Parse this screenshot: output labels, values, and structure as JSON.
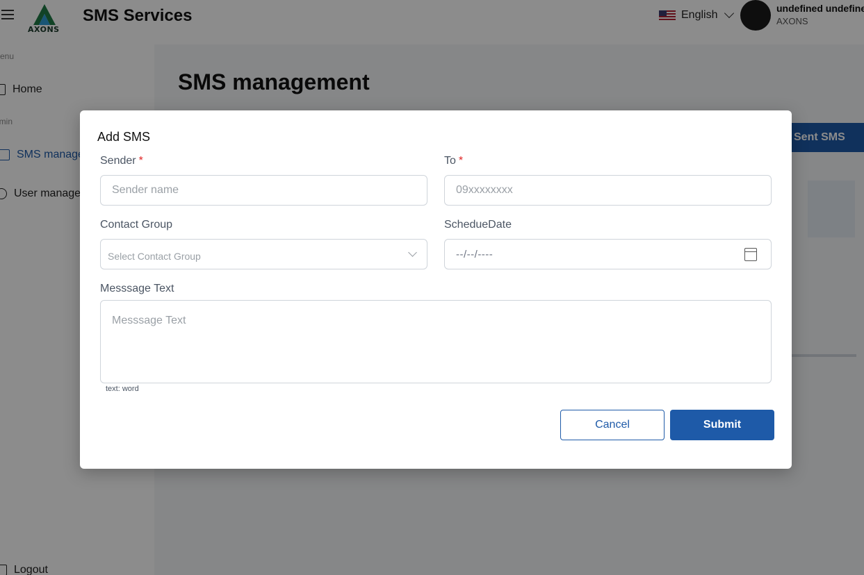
{
  "header": {
    "app_title": "SMS Services",
    "logo_text": "AXONS",
    "language": "English",
    "user_name": "undefined undefined",
    "user_org": "AXONS"
  },
  "sidebar": {
    "menu_label": "Menu",
    "admin_label": "Admin",
    "items": [
      {
        "label": "Home",
        "active": false
      },
      {
        "label": "SMS management",
        "active": true
      },
      {
        "label": "User management",
        "active": false
      }
    ],
    "logout_label": "Logout"
  },
  "main": {
    "page_title": "SMS management",
    "sent_button_label": "Sent SMS"
  },
  "modal": {
    "title": "Add SMS",
    "sender": {
      "label": "Sender",
      "required": "*",
      "placeholder": "Sender name"
    },
    "to": {
      "label": "To",
      "required": "*",
      "placeholder": "09xxxxxxxx"
    },
    "contact_group": {
      "label": "Contact Group",
      "placeholder": "Select Contact Group"
    },
    "schedule_date": {
      "label": "SchedueDate",
      "placeholder": "--/--/----"
    },
    "message": {
      "label": "Messsage Text",
      "placeholder": "Messsage Text",
      "hint": "text: word"
    },
    "cancel_label": "Cancel",
    "submit_label": "Submit"
  },
  "colors": {
    "primary": "#1e5aa8",
    "required": "#e02424",
    "overlay": "rgba(0,0,0,0.45)"
  }
}
